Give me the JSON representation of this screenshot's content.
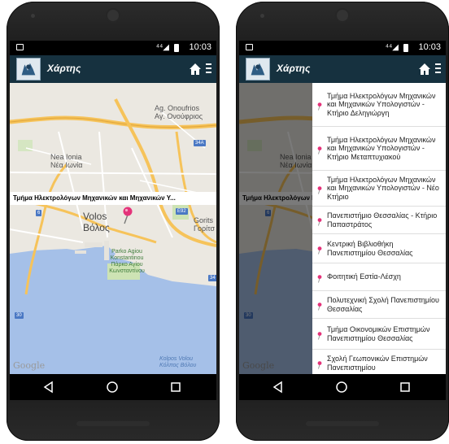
{
  "status": {
    "time": "10:03",
    "signal": "⁴⁴◢"
  },
  "appbar": {
    "title": "Χάρτης"
  },
  "map": {
    "labels": {
      "ag_onoufrios": "Ag. Onoufrios",
      "ag_onoufrios_gr": "Αγ. Ονούφριος",
      "nea_ionia": "Nea Ionia",
      "nea_ionia_gr": "Νέα Ιωνία",
      "volos": "Volos",
      "volos_gr": "Βόλος",
      "gorits": "Gorits",
      "gorits_gr": "Γορίτσ",
      "park": "Parko Agiou Konstantinou Πάρκο Αγίου Κωνσταντίνου",
      "kolpos": "Kolpos Volou Κόλπος Βόλου",
      "google": "Google"
    },
    "road_badges": {
      "r34a": "34A",
      "r6": "6",
      "re92": "E92",
      "r34": "34",
      "r30": "30"
    },
    "banner": "Τμήμα Ηλεκτρολόγων Μηχανικών και Μηχανικών Υ..."
  },
  "drawer": {
    "items": [
      {
        "label": "Τμήμα Ηλεκτρολόγων Μηχανικών και Μηχανικών Υπολογιστών - Κτήριο Δεληγιώργη"
      },
      {
        "label": "Τμήμα Ηλεκτρολόγων Μηχανικών και Μηχανικών Υπολογιστών - Κτήριο Μεταπτυχιακού"
      },
      {
        "label": "Τμήμα Ηλεκτρολόγων Μηχανικών και Μηχανικών Υπολογιστών - Νέο Κτήριο"
      },
      {
        "label": "Πανεπιστήμιο Θεσσαλίας - Κτήριο Παπαστράτος"
      },
      {
        "label": "Κεντρική Βιβλιοθήκη Πανεπιστημίου Θεσσαλίας"
      },
      {
        "label": "Φοιτητική Εστία-Λέσχη"
      },
      {
        "label": "Πολυτεχνική Σχολή Πανεπιστημίου Θεσσαλίας"
      },
      {
        "label": "Τμήμα Οικονομικών Επιστημών Πανεπιστημίου Θεσσαλίας"
      },
      {
        "label": "Σχολή Γεωπονικών Επιστημών Πανεπιστημίου"
      }
    ]
  },
  "colors": {
    "appbar": "#16313f",
    "water": "#a5c0e8",
    "road_major": "#f6c35a",
    "park": "#cde3b4",
    "pin": "#e4337a"
  },
  "icons": {
    "home": "home-icon",
    "menu": "overflow-menu-icon",
    "back": "back-icon",
    "home_nav": "home-circle-icon",
    "recents": "recents-icon",
    "pin": "map-pin-icon"
  }
}
